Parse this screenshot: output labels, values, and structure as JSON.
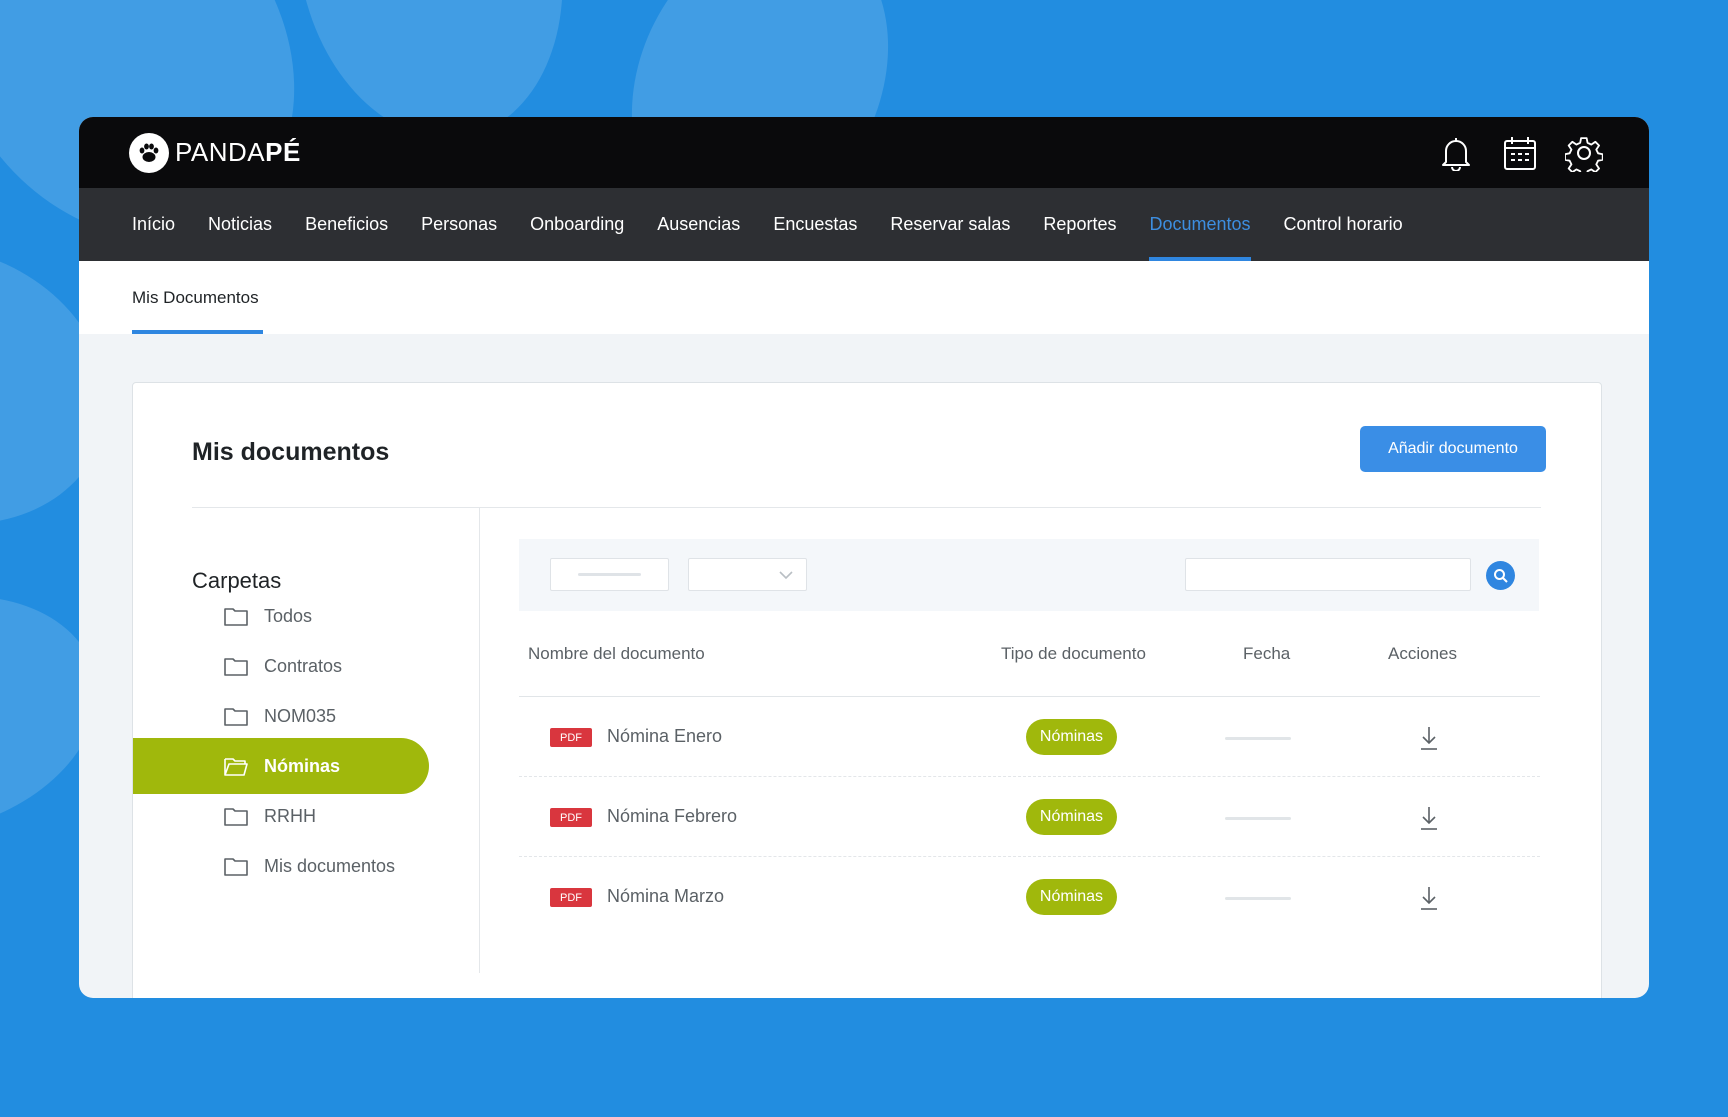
{
  "brand": {
    "name_light": "PANDA",
    "name_bold": "PÉ"
  },
  "topbar": {
    "icons": [
      "bell-icon",
      "calendar-icon",
      "gear-icon"
    ]
  },
  "nav": {
    "items": [
      "Início",
      "Noticias",
      "Beneficios",
      "Personas",
      "Onboarding",
      "Ausencias",
      "Encuestas",
      "Reservar salas",
      "Reportes",
      "Documentos",
      "Control horario"
    ],
    "active": "Documentos"
  },
  "subnav": {
    "tab": "Mis Documentos"
  },
  "card": {
    "title": "Mis documentos",
    "add_button": "Añadir documento"
  },
  "folders": {
    "title": "Carpetas",
    "items": [
      "Todos",
      "Contratos",
      "NOM035",
      "Nóminas",
      "RRHH",
      "Mis documentos"
    ],
    "active": "Nóminas"
  },
  "filters": {
    "date_value": "",
    "select_value": "",
    "search_value": ""
  },
  "table": {
    "headers": [
      "Nombre del documento",
      "Tipo de documento",
      "Fecha",
      "Acciones"
    ],
    "rows": [
      {
        "badge": "PDF",
        "name": "Nómina Enero",
        "type": "Nóminas"
      },
      {
        "badge": "PDF",
        "name": "Nómina Febrero",
        "type": "Nóminas"
      },
      {
        "badge": "PDF",
        "name": "Nómina Marzo",
        "type": "Nóminas"
      }
    ]
  },
  "colors": {
    "background": "#228de0",
    "accent_blue": "#2f86e0",
    "accent_green": "#a0b80c",
    "pdf_red": "#d9363e",
    "topbar": "#0a0a0c",
    "navbar": "#2d2f33"
  }
}
